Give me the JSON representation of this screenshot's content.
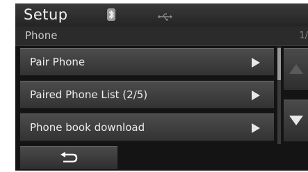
{
  "header": {
    "title": "Setup",
    "status_icons": [
      "bluetooth-icon",
      "usb-icon"
    ]
  },
  "subheader": {
    "label": "Phone",
    "page_indicator": "1/"
  },
  "menu": {
    "items": [
      {
        "label": "Pair Phone",
        "icon": "chevron-right-icon"
      },
      {
        "label": "Paired Phone List  (2/5)",
        "icon": "chevron-right-icon"
      },
      {
        "label": "Phone book download",
        "icon": "chevron-right-icon"
      }
    ]
  },
  "scroll": {
    "up_icon": "arrow-up-icon",
    "down_icon": "arrow-down-icon",
    "up_enabled": false,
    "down_enabled": true
  },
  "footer": {
    "back_icon": "back-icon"
  },
  "colors": {
    "background": "#141414",
    "item_bg": "#404040",
    "text": "#eeeeee",
    "disabled_arrow": "#5a5a5a"
  }
}
